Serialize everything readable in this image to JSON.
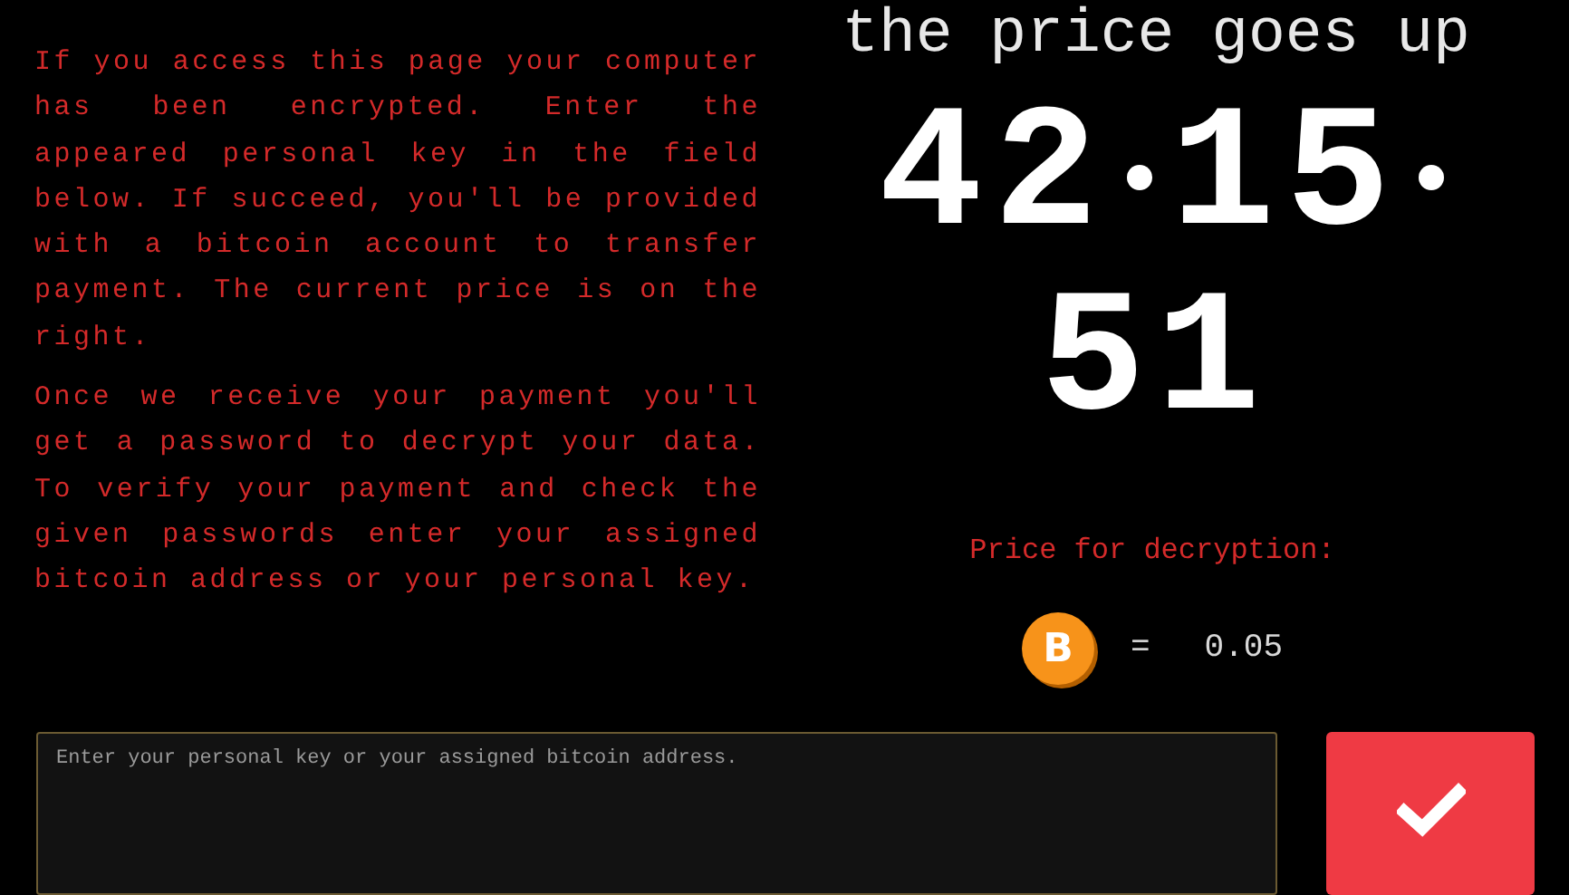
{
  "message": {
    "paragraphs": [
      "If you access this page your computer has been encrypted. Enter the appeared personal key in the field below. If succeed, you'll be provided with a bitcoin account to transfer payment. The current price is on the right.",
      "Once we receive your payment you'll get a password to decrypt your data. To verify your payment and check the given passwords enter your assigned bitcoin address or your personal key."
    ]
  },
  "countdown": {
    "heading": "the price goes up",
    "hours": "42",
    "minutes": "15",
    "seconds": "51"
  },
  "price": {
    "label": "Price for decryption:",
    "coin_symbol": "B",
    "equals": "=",
    "amount": "0.05"
  },
  "key_input": {
    "placeholder": "Enter your personal key or your assigned bitcoin address."
  }
}
